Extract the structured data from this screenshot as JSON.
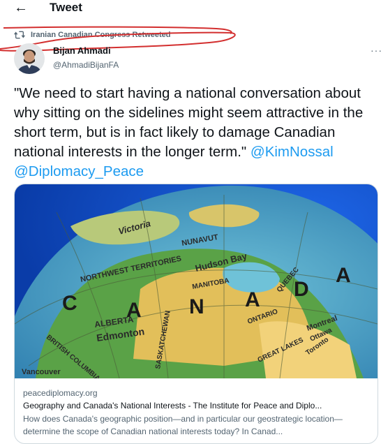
{
  "header": {
    "back_icon": "arrow-left-icon",
    "title": "Tweet"
  },
  "retweet": {
    "icon": "retweet-icon",
    "text": "Iranian Canadian Congress Retweeted"
  },
  "author": {
    "name": "Bijan Ahmadi",
    "handle": "@AhmadiBijanFA",
    "avatar_icon": "avatar"
  },
  "more_label": "···",
  "tweet": {
    "text": "\"We need to start having a national conversation about why sitting on the sidelines might seem attractive in the short term, but is in fact likely to damage Canadian national interests in the longer term.\"",
    "mention_1": "@KimNossal",
    "mention_2": "@Diplomacy_Peace"
  },
  "card": {
    "image_labels": [
      "NUNAVUT",
      "Victoria",
      "NORTHWEST TERRITORIES",
      "Hudson Bay",
      "MANITOBA",
      "QUEBEC",
      "ONTARIO",
      "ALBERTA",
      "Edmonton",
      "BRITISH COLUMBIA",
      "SASKATCHEWAN",
      "Vancouver",
      "Montreal",
      "Ottawa",
      "Toronto",
      "GREAT LAKES",
      "C",
      "A",
      "N",
      "A",
      "D",
      "A"
    ],
    "domain": "peacediplomacy.org",
    "title": "Geography and Canada's National Interests - The Institute for Peace and Diplo...",
    "description": "How does Canada's geographic position—and in particular our geostrategic location—determine the scope of Canadian national interests today? In Canad..."
  },
  "colors": {
    "accent": "#1d9bf0",
    "annotation": "#d32f2f",
    "text": "#0f1419",
    "secondary": "#536471"
  }
}
